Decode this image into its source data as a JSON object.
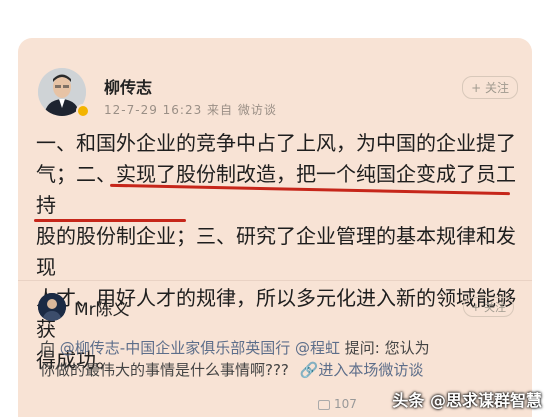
{
  "post": {
    "author": "柳传志",
    "meta": "12-7-29 16:23  来自 微访谈",
    "follow_label": "+ 关注",
    "lines": [
      "一、和国外企业的竞争中占了上风，为中国的企业提了",
      "气；二、实现了股份制改造，把一个纯国企变成了员工持",
      "股的股份制企业；三、研究了企业管理的基本规律和发现",
      "人才、用好人才的规律，所以多元化进入新的领域能够获",
      "得成功。"
    ]
  },
  "reply": {
    "name": "Mr陈义",
    "follow_label": "+ 关注",
    "prefix": "向 ",
    "mention1": "@柳传志-中国企业家俱乐部英国行",
    "mention2": "@程虹",
    "question": " 提问: 您认为",
    "line2": "你做的最伟大的事情是什么事情啊???",
    "enter_label": "进入本场微访谈",
    "repost_count": "107"
  },
  "watermark": "头条 @思求谋群智慧"
}
